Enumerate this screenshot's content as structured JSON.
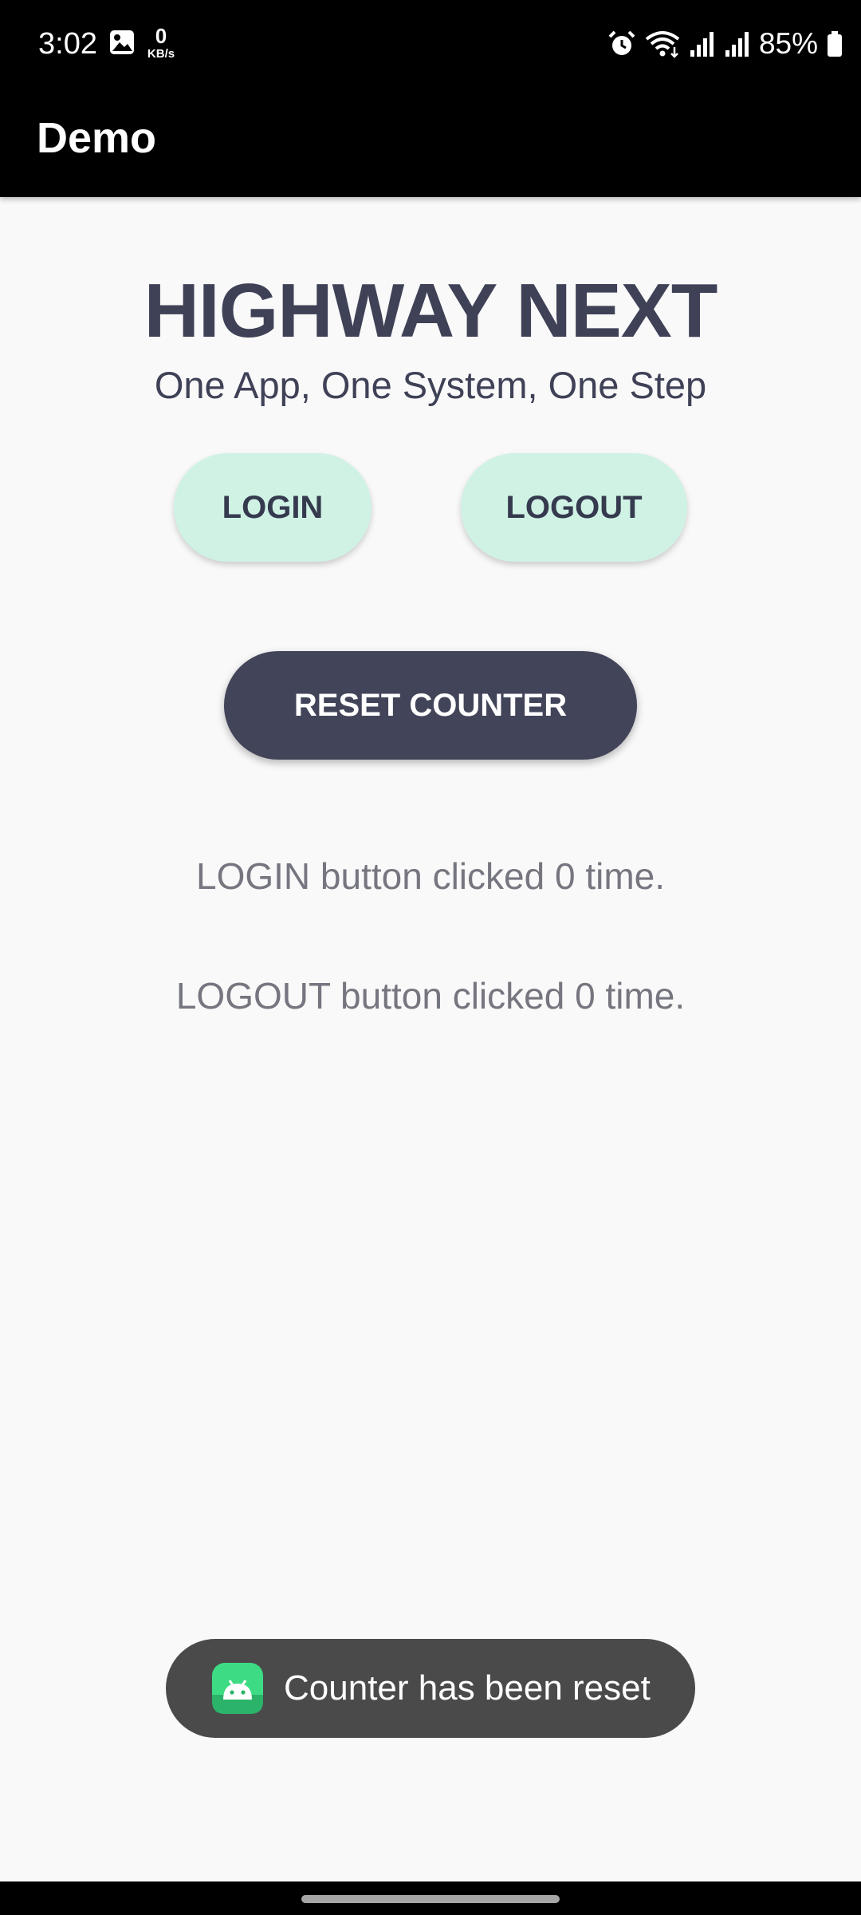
{
  "status_bar": {
    "time": "3:02",
    "net_speed_value": "0",
    "net_speed_unit": "KB/s",
    "battery": "85%",
    "icons": [
      "image-icon",
      "alarm-icon",
      "wifi-icon",
      "signal-icon",
      "signal-icon",
      "battery-icon"
    ]
  },
  "app_bar": {
    "title": "Demo"
  },
  "main": {
    "headline": "HIGHWAY NEXT",
    "tagline": "One App, One System, One Step",
    "login_button": "LOGIN",
    "logout_button": "LOGOUT",
    "reset_button": "RESET COUNTER",
    "login_count_text": "LOGIN button clicked 0 time.",
    "logout_count_text": "LOGOUT button clicked 0 time."
  },
  "toast": {
    "icon": "android-app-icon",
    "message": "Counter has been reset"
  },
  "colors": {
    "app_bar_bg": "#000000",
    "text_primary": "#3f4157",
    "pill_bg": "#cff2e4",
    "reset_bg": "#424459",
    "toast_bg": "#4a4a4a"
  }
}
